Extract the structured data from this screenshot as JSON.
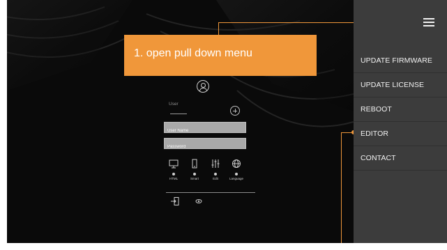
{
  "callout": {
    "text": "1. open pull down menu"
  },
  "menu": {
    "items": [
      {
        "label": "UPDATE FIRMWARE"
      },
      {
        "label": "UPDATE LICENSE"
      },
      {
        "label": "REBOOT"
      },
      {
        "label": "EDITOR"
      },
      {
        "label": "CONTACT"
      }
    ]
  },
  "login": {
    "user_tab_label": "User",
    "username_placeholder": "User Name",
    "password_placeholder": "Password",
    "modes": [
      {
        "label": "HTML",
        "icon": "monitor-icon"
      },
      {
        "label": "Smart",
        "icon": "smartphone-icon"
      },
      {
        "label": "Edit",
        "icon": "sliders-icon"
      },
      {
        "label": "Language",
        "icon": "globe-icon"
      }
    ],
    "bottom_icons": [
      "login-icon",
      "eye-icon"
    ]
  },
  "colors": {
    "accent": "#f0973a",
    "panel": "#3c3c3c",
    "background": "#0b0b0b"
  }
}
